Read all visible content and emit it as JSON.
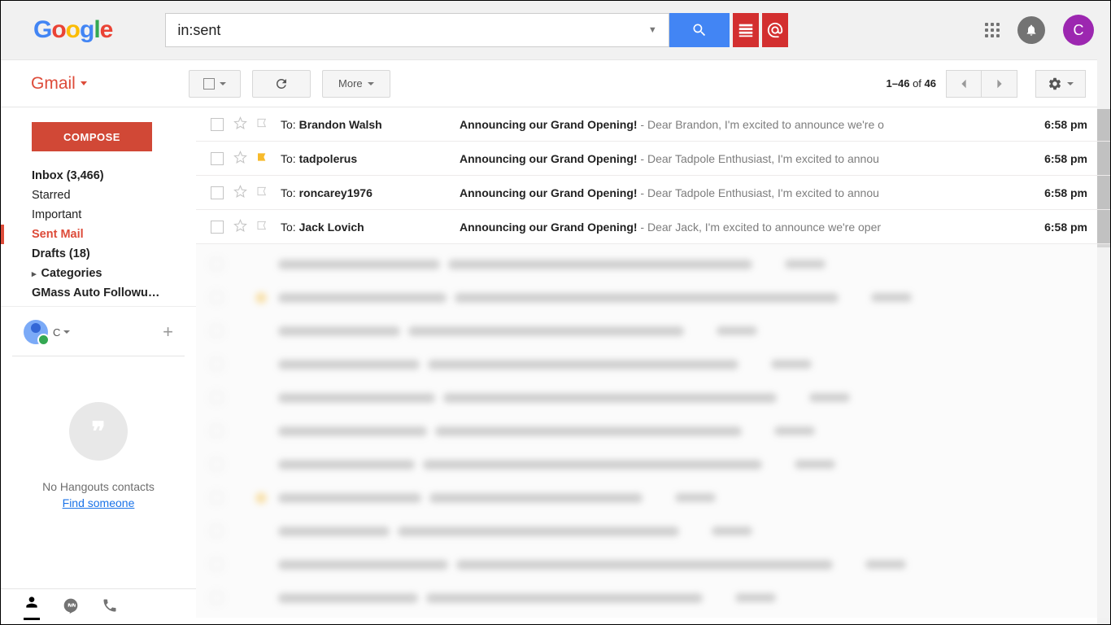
{
  "search": {
    "value": "in:sent"
  },
  "avatar_letter": "C",
  "gmail_label": "Gmail",
  "toolbar": {
    "more": "More",
    "page_range": "1–46",
    "page_of": " of ",
    "page_total": "46"
  },
  "compose": "COMPOSE",
  "sidebar": {
    "items": [
      {
        "label": "Inbox (3,466)",
        "bold": true
      },
      {
        "label": "Starred"
      },
      {
        "label": "Important"
      },
      {
        "label": "Sent Mail",
        "active": true
      },
      {
        "label": "Drafts (18)",
        "bold": true
      },
      {
        "label": "Categories",
        "cat": true,
        "bold": true
      },
      {
        "label": "GMass Auto Followu…",
        "bold": true
      }
    ]
  },
  "hangouts": {
    "user": "C",
    "no_contacts": "No Hangouts contacts",
    "find": "Find someone"
  },
  "emails": [
    {
      "to_prefix": "To: ",
      "name": "Brandon Walsh",
      "subject": "Announcing our Grand Opening!",
      "preview": " - Dear Brandon, I'm excited to announce we're o",
      "time": "6:58 pm",
      "tagged": false
    },
    {
      "to_prefix": "To: ",
      "name": "tadpolerus",
      "subject": "Announcing our Grand Opening!",
      "preview": " - Dear Tadpole Enthusiast, I'm excited to annou",
      "time": "6:58 pm",
      "tagged": true
    },
    {
      "to_prefix": "To: ",
      "name": "roncarey1976",
      "subject": "Announcing our Grand Opening!",
      "preview": " - Dear Tadpole Enthusiast, I'm excited to annou",
      "time": "6:58 pm",
      "tagged": false
    },
    {
      "to_prefix": "To: ",
      "name": "Jack Lovich",
      "subject": "Announcing our Grand Opening!",
      "preview": " - Dear Jack, I'm excited to announce we're oper",
      "time": "6:58 pm",
      "tagged": false
    }
  ]
}
